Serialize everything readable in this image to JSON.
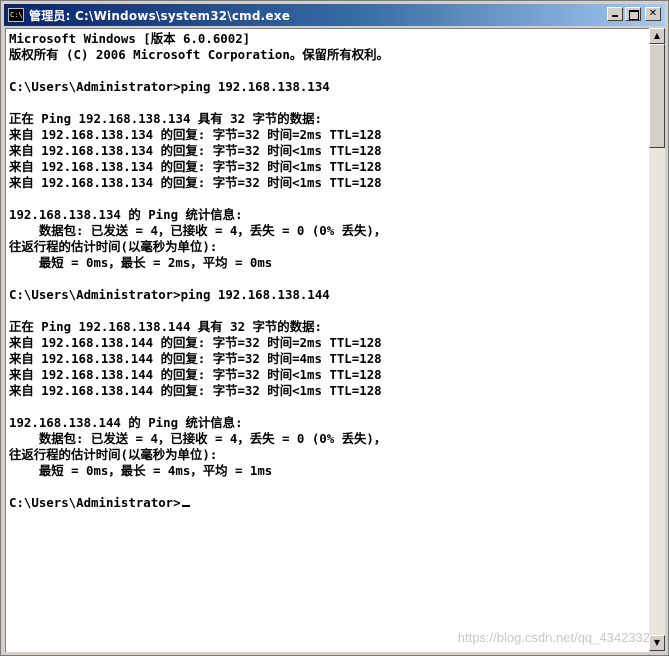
{
  "window": {
    "title": "管理员: C:\\Windows\\system32\\cmd.exe",
    "icon_label": "C:\\"
  },
  "console": {
    "lines": [
      "Microsoft Windows [版本 6.0.6002]",
      "版权所有 (C) 2006 Microsoft Corporation。保留所有权利。",
      "",
      "C:\\Users\\Administrator>ping 192.168.138.134",
      "",
      "正在 Ping 192.168.138.134 具有 32 字节的数据:",
      "来自 192.168.138.134 的回复: 字节=32 时间=2ms TTL=128",
      "来自 192.168.138.134 的回复: 字节=32 时间<1ms TTL=128",
      "来自 192.168.138.134 的回复: 字节=32 时间<1ms TTL=128",
      "来自 192.168.138.134 的回复: 字节=32 时间<1ms TTL=128",
      "",
      "192.168.138.134 的 Ping 统计信息:",
      "    数据包: 已发送 = 4，已接收 = 4，丢失 = 0 (0% 丢失)，",
      "往返行程的估计时间(以毫秒为单位):",
      "    最短 = 0ms，最长 = 2ms，平均 = 0ms",
      "",
      "C:\\Users\\Administrator>ping 192.168.138.144",
      "",
      "正在 Ping 192.168.138.144 具有 32 字节的数据:",
      "来自 192.168.138.144 的回复: 字节=32 时间=2ms TTL=128",
      "来自 192.168.138.144 的回复: 字节=32 时间=4ms TTL=128",
      "来自 192.168.138.144 的回复: 字节=32 时间<1ms TTL=128",
      "来自 192.168.138.144 的回复: 字节=32 时间<1ms TTL=128",
      "",
      "192.168.138.144 的 Ping 统计信息:",
      "    数据包: 已发送 = 4，已接收 = 4，丢失 = 0 (0% 丢失)，",
      "往返行程的估计时间(以毫秒为单位):",
      "    最短 = 0ms，最长 = 4ms，平均 = 1ms",
      ""
    ],
    "prompt": "C:\\Users\\Administrator>"
  },
  "watermark": "https://blog.csdn.net/qq_4342332",
  "colors": {
    "title_active_start": "#0a246a",
    "title_active_end": "#a6caf0",
    "console_bg": "#ffffff",
    "console_text": "#000000"
  },
  "icons": {
    "app": "cmd-icon",
    "minimize": "minimize-icon",
    "maximize": "maximize-icon",
    "close": "close-icon",
    "scroll_up": "arrow-up-icon",
    "scroll_down": "arrow-down-icon"
  }
}
